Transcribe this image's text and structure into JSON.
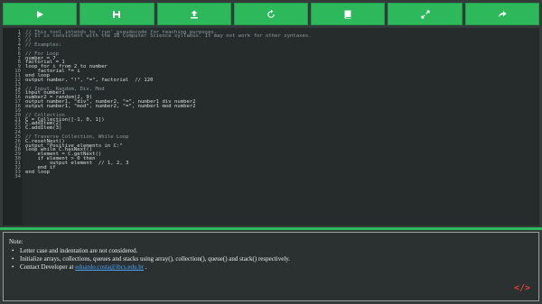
{
  "toolbar": {
    "buttons": [
      {
        "name": "run",
        "icon": "play-icon"
      },
      {
        "name": "save",
        "icon": "save-icon"
      },
      {
        "name": "upload",
        "icon": "upload-icon"
      },
      {
        "name": "refresh",
        "icon": "refresh-icon"
      },
      {
        "name": "book",
        "icon": "book-icon"
      },
      {
        "name": "fullscreen",
        "icon": "expand-icon"
      },
      {
        "name": "share",
        "icon": "share-icon"
      }
    ]
  },
  "editor": {
    "lines": [
      "// This tool intends to 'run' pseudocode for teaching purposes.",
      "// It is consistent with the IB Computer Science syllabus. It may not work for other syntaxes.",
      "//",
      "// Examples:",
      "",
      "// For Loop",
      "number = 7",
      "factorial = 1",
      "loop for i from 2 to number",
      "    factorial *= i",
      "end loop",
      "output number, \"!\", \"=\", factorial  // 120",
      "",
      "// Input, Random, Div, Mod",
      "input number1",
      "number2 = random(2, 9)",
      "output number1, \"div\", number2, \"=\", number1 div number2",
      "output number1, \"mod\", number2, \"=\", number1 mod number2",
      "",
      "// Collection",
      "C = Collection([-1, 0, 1])",
      "C.addItem(2)",
      "C.addItem(3)",
      "",
      "// Traverse Collection, While Loop",
      "C.resetNext()",
      "output \"Positive elements in C:\"",
      "loop while C.hasNext()",
      "    element = C.getNext()",
      "    if element > 0 then",
      "        output element  // 1, 2, 3",
      "    end if",
      "end loop",
      ""
    ]
  },
  "note": {
    "title": "Note:",
    "items": [
      "Letter case and indentation are not considered.",
      "Initialize arrays, collections, queues and stacks using array(), collection(), queue() and stack() respectively."
    ],
    "contact_prefix": "Contact Developer at ",
    "contact_link": "eduardo.costa@ibcs.edu.br",
    "contact_suffix": " .",
    "footer_icon": "code-icon"
  }
}
